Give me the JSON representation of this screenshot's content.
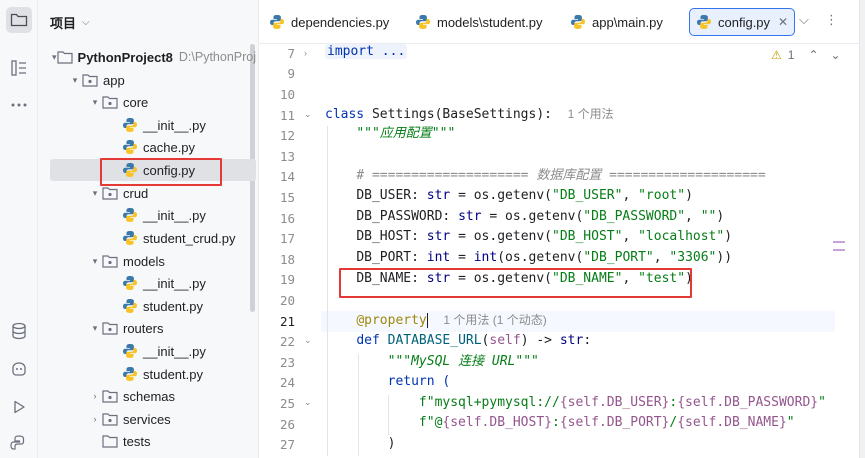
{
  "toolstrip": {
    "icons": [
      "folder-icon",
      "structure-icon",
      "more-icon",
      "database-icon",
      "python-packages-icon",
      "run-icon",
      "python-console-icon"
    ]
  },
  "project": {
    "title": "项目",
    "root_name": "PythonProject8",
    "root_path": "D:\\PythonProj",
    "tree": [
      {
        "label": "app"
      },
      {
        "label": "core"
      },
      {
        "label": "__init__.py"
      },
      {
        "label": "cache.py"
      },
      {
        "label": "config.py"
      },
      {
        "label": "crud"
      },
      {
        "label": "__init__.py"
      },
      {
        "label": "student_crud.py"
      },
      {
        "label": "models"
      },
      {
        "label": "__init__.py"
      },
      {
        "label": "student.py"
      },
      {
        "label": "routers"
      },
      {
        "label": "__init__.py"
      },
      {
        "label": "student.py"
      },
      {
        "label": "schemas"
      },
      {
        "label": "services"
      },
      {
        "label": "tests"
      }
    ]
  },
  "tabs": [
    {
      "label": "dependencies.py"
    },
    {
      "label": "models\\student.py"
    },
    {
      "label": "app\\main.py"
    },
    {
      "label": "config.py"
    }
  ],
  "editor": {
    "inspection_count": "1",
    "line_numbers": [
      "7",
      "9",
      "10",
      "11",
      "12",
      "13",
      "14",
      "15",
      "16",
      "17",
      "18",
      "19",
      "20",
      "21",
      "22",
      "23",
      "24",
      "25",
      "26",
      "27"
    ],
    "usage_hint_1": "1 个用法",
    "usage_hint_2": "1 个用法 (1 个动态)",
    "code": {
      "l7": "import ...",
      "l11_kw": "class ",
      "l11_name": "Settings(BaseSettings):",
      "l12": "\"\"\"应用配置\"\"\"",
      "l14": "# ==================== 数据库配置 ====================",
      "l15_a": "DB_USER: ",
      "l15_b": "str",
      "l15_c": " = os.getenv(",
      "l15_d": "\"DB_USER\"",
      "l15_e": ", ",
      "l15_f": "\"root\"",
      "l15_g": ")",
      "l16_a": "DB_PASSWORD: ",
      "l16_b": "str",
      "l16_c": " = os.getenv(",
      "l16_d": "\"DB_PASSWORD\"",
      "l16_e": ", ",
      "l16_f": "\"\"",
      "l16_g": ")",
      "l17_a": "DB_HOST: ",
      "l17_b": "str",
      "l17_c": " = os.getenv(",
      "l17_d": "\"DB_HOST\"",
      "l17_e": ", ",
      "l17_f": "\"localhost\"",
      "l17_g": ")",
      "l18_a": "DB_PORT: ",
      "l18_b": "int",
      "l18_c": " = ",
      "l18_d": "int",
      "l18_e": "(os.getenv(",
      "l18_f": "\"DB_PORT\"",
      "l18_g": ", ",
      "l18_h": "\"3306\"",
      "l18_i": "))",
      "l19_a": "DB_NAME: ",
      "l19_b": "str",
      "l19_c": " = os.getenv(",
      "l19_d": "\"DB_NAME\"",
      "l19_e": ", ",
      "l19_f": "\"test\"",
      "l19_g": ")",
      "l21": "@property",
      "l22_a": "def ",
      "l22_b": "DATABASE_URL",
      "l22_c": "(",
      "l22_d": "self",
      "l22_e": ") -> ",
      "l22_f": "str",
      "l22_g": ":",
      "l23": "\"\"\"MySQL 连接 URL\"\"\"",
      "l24": "return (",
      "l25_a": "f\"mysql+pymysql://",
      "l25_b": "{self.DB_USER}",
      "l25_c": ":",
      "l25_d": "{self.DB_PASSWORD}",
      "l25_e": "\"",
      "l26_a": "f\"@",
      "l26_b": "{self.DB_HOST}",
      "l26_c": ":",
      "l26_d": "{self.DB_PORT}",
      "l26_e": "/",
      "l26_f": "{self.DB_NAME}",
      "l26_g": "\"",
      "l27": ")"
    }
  },
  "colors": {
    "highlight_box": "#e53935",
    "tab_active_border": "#3574f0",
    "keyword": "#0033b3",
    "string": "#067d17"
  }
}
